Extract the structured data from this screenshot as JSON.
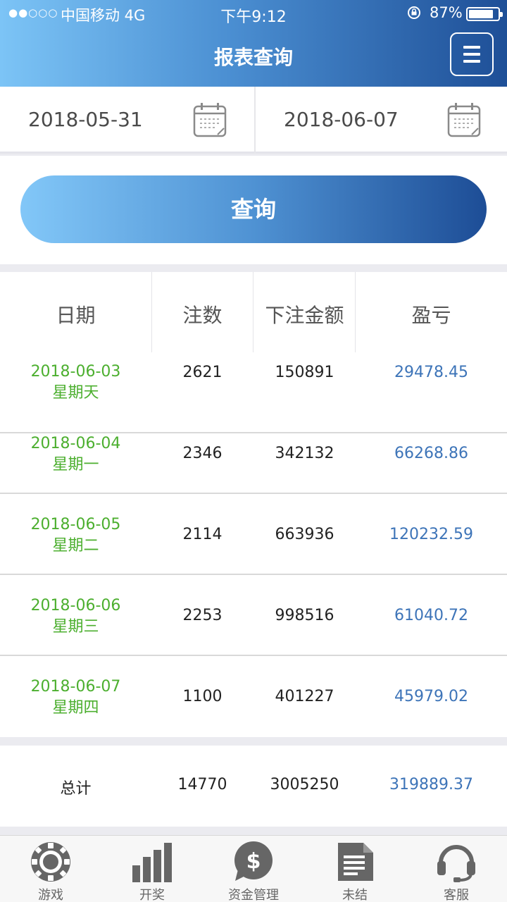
{
  "status_bar": {
    "signal": "●●○○○",
    "carrier": "中国移动  4G",
    "time": "下午9:12",
    "battery": "87%"
  },
  "header": {
    "title": "报表查询",
    "menu_icon": "hamburger-menu-icon"
  },
  "filters": {
    "start_date": "2018-05-31",
    "end_date": "2018-06-07",
    "calendar_icon": "calendar-icon",
    "query_label": "查询"
  },
  "table": {
    "headers": [
      "日期",
      "注数",
      "下注金额",
      "盈亏"
    ],
    "rows": [
      {
        "date": "2018-06-03",
        "weekday": "星期天",
        "count": "2621",
        "amount": "150891",
        "profit": "29478.45"
      },
      {
        "date": "2018-06-04",
        "weekday": "星期一",
        "count": "2346",
        "amount": "342132",
        "profit": "66268.86"
      },
      {
        "date": "2018-06-05",
        "weekday": "星期二",
        "count": "2114",
        "amount": "663936",
        "profit": "120232.59"
      },
      {
        "date": "2018-06-06",
        "weekday": "星期三",
        "count": "2253",
        "amount": "998516",
        "profit": "61040.72"
      },
      {
        "date": "2018-06-07",
        "weekday": "星期四",
        "count": "1100",
        "amount": "401227",
        "profit": "45979.02"
      }
    ],
    "total": {
      "label": "总计",
      "count": "14770",
      "amount": "3005250",
      "profit": "319889.37"
    }
  },
  "tabbar": {
    "items": [
      {
        "label": "游戏",
        "icon": "poker-chip-icon"
      },
      {
        "label": "开奖",
        "icon": "bar-chart-icon"
      },
      {
        "label": "资金管理",
        "icon": "dollar-bubble-icon"
      },
      {
        "label": "未结",
        "icon": "document-icon"
      },
      {
        "label": "客服",
        "icon": "headset-icon"
      }
    ]
  },
  "colors": {
    "accent_light": "#7cc4f6",
    "accent_dark": "#1e4f97",
    "date_green": "#4caf2f",
    "profit_blue": "#3d74b8"
  }
}
